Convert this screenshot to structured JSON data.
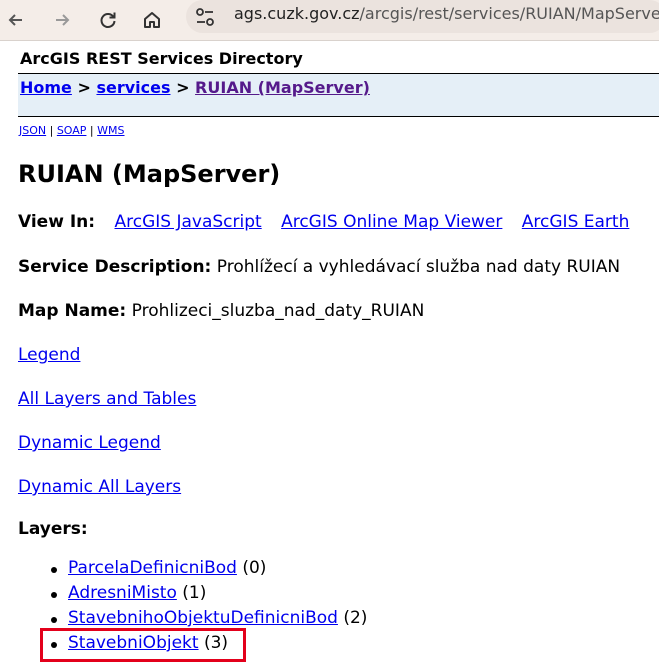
{
  "browser": {
    "url_host": "ags.cuzk.gov.cz",
    "url_path": "/arcgis/rest/services/RUIAN/MapServer",
    "back_icon": "arrow-left-icon",
    "forward_icon": "arrow-right-icon",
    "reload_icon": "reload-icon",
    "home_icon": "home-icon",
    "site_info_icon": "tune-icon"
  },
  "header": {
    "directory_title": "ArcGIS REST Services Directory",
    "breadcrumb": {
      "home": "Home",
      "sep1": " > ",
      "services": "services",
      "sep2": " > ",
      "current": "RUIAN (MapServer)"
    },
    "formats": {
      "json": "JSON",
      "sep1": " | ",
      "soap": "SOAP",
      "sep2": " | ",
      "wms": "WMS"
    }
  },
  "main": {
    "title": "RUIAN (MapServer)",
    "view_in": {
      "label": "View In:",
      "links": [
        "ArcGIS JavaScript",
        "ArcGIS Online Map Viewer",
        "ArcGIS Earth"
      ]
    },
    "service_description": {
      "label": "Service Description:",
      "value": "Prohlížecí a vyhledávací služba nad daty RUIAN"
    },
    "map_name": {
      "label": "Map Name:",
      "value": "Prohlizeci_sluzba_nad_daty_RUIAN"
    },
    "links": {
      "legend": "Legend",
      "all_layers": "All Layers and Tables",
      "dynamic_legend": "Dynamic Legend",
      "dynamic_all_layers": "Dynamic All Layers"
    },
    "layers_label": "Layers:",
    "layers": [
      {
        "name": "ParcelaDefinicniBod",
        "id": "(0)"
      },
      {
        "name": "AdresniMisto",
        "id": "(1)"
      },
      {
        "name": "StavebnihoObjektuDefinicniBod",
        "id": "(2)"
      },
      {
        "name": "StavebniObjekt",
        "id": "(3)"
      }
    ]
  },
  "colors": {
    "highlight": "#e3001b",
    "link": "#0000ee",
    "visited": "#551a8b",
    "crumb_bg": "#e5eff7"
  }
}
